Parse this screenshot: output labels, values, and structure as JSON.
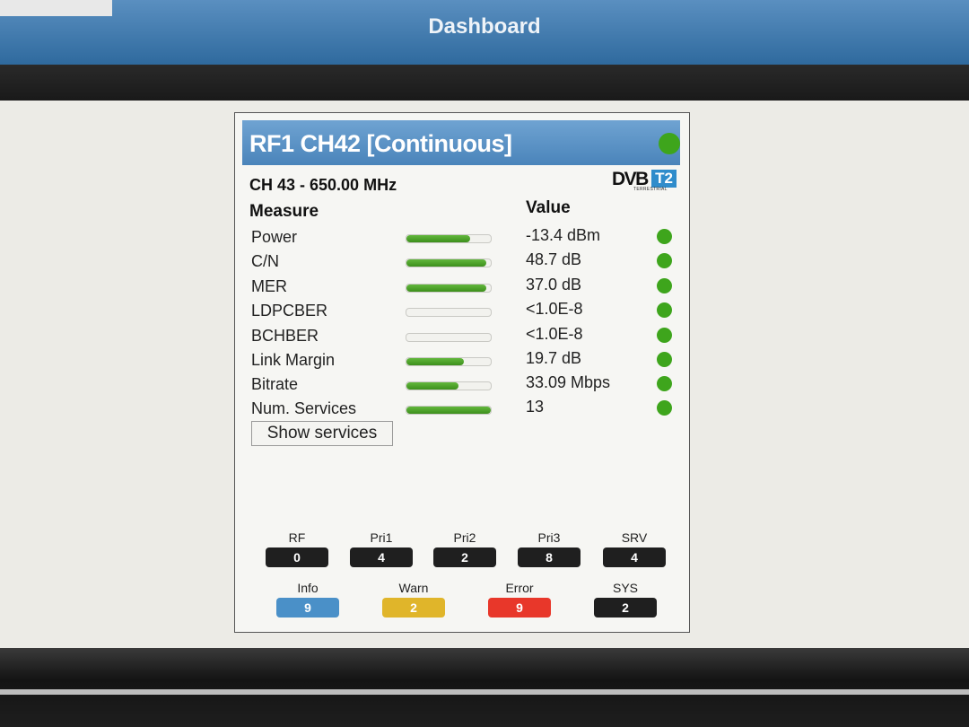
{
  "header": {
    "title": "Dashboard"
  },
  "panel": {
    "title": "RF1 CH42 [Continuous]",
    "frequency": "CH 43 - 650.00 MHz",
    "logo": {
      "dvb": "DVB",
      "t2": "T2",
      "sub": "TERRESTRIAL"
    },
    "columns": {
      "measure": "Measure",
      "value": "Value"
    },
    "rows": [
      {
        "label": "Power",
        "value": "-13.4 dBm",
        "level": 0.75
      },
      {
        "label": "C/N",
        "value": "48.7 dB",
        "level": 0.95
      },
      {
        "label": "MER",
        "value": "37.0 dB",
        "level": 0.95
      },
      {
        "label": "LDPCBER",
        "value": "<1.0E-8",
        "level": 0
      },
      {
        "label": "BCHBER",
        "value": "<1.0E-8",
        "level": 0
      },
      {
        "label": "Link Margin",
        "value": "19.7 dB",
        "level": 0.68
      },
      {
        "label": "Bitrate",
        "value": "33.09 Mbps",
        "level": 0.62
      },
      {
        "label": "Num. Services",
        "value": "13",
        "level": 1.0
      }
    ],
    "show_services_label": "Show services",
    "counters_top": [
      {
        "label": "RF",
        "count": "0"
      },
      {
        "label": "Pri1",
        "count": "4"
      },
      {
        "label": "Pri2",
        "count": "2"
      },
      {
        "label": "Pri3",
        "count": "8"
      },
      {
        "label": "SRV",
        "count": "4"
      }
    ],
    "counters_bottom": [
      {
        "label": "Info",
        "count": "9",
        "color": "#4a90c8"
      },
      {
        "label": "Warn",
        "count": "2",
        "color": "#e0b52a"
      },
      {
        "label": "Error",
        "count": "9",
        "color": "#e8372a"
      },
      {
        "label": "SYS",
        "count": "2",
        "color": "#1f1f1f"
      }
    ],
    "colors": {
      "ok": "#3ea51c",
      "header": "#4a84ba",
      "bar": "#4fa52a"
    }
  }
}
